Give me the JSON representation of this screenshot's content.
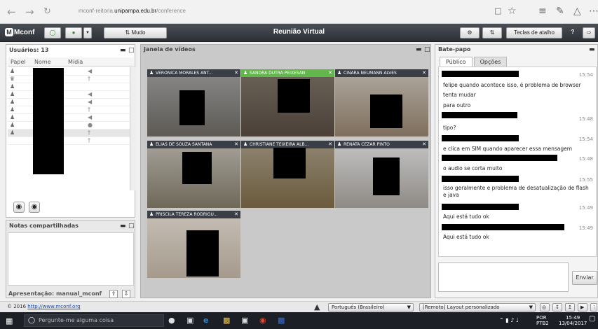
{
  "browser": {
    "url_prefix": "mconf-reitoria.",
    "url_domain": "unipampa.edu.br",
    "url_path": "/conference"
  },
  "toolbar": {
    "logo": "Mconf",
    "mute_label": "Mudo",
    "title": "Reunião Virtual",
    "shortcuts_label": "Teclas de atalho",
    "help_label": "?"
  },
  "users": {
    "title": "Usuários: 13",
    "col_role": "Papel",
    "col_name": "Nome",
    "col_media": "Mídia"
  },
  "notes": {
    "title": "Notas compartilhadas"
  },
  "presentation": {
    "label": "Apresentação: manual_mconf"
  },
  "video": {
    "title": "Janela de vídeos",
    "tiles": [
      {
        "name": "VERONICA MORALES ANT..."
      },
      {
        "name": "SANDRA DUTRA PEIXESAN"
      },
      {
        "name": "CINARA NEUMANN ALVES"
      },
      {
        "name": "ELIAS DE SOUZA SANTANA"
      },
      {
        "name": "CHRISTIANE TEIXEIRA ALB..."
      },
      {
        "name": "RENATA CEZAR PINTO"
      },
      {
        "name": "PRISCILA TEREZA RODRIGU..."
      }
    ]
  },
  "chat": {
    "title": "Bate-papo",
    "tab_public": "Público",
    "tab_options": "Opções",
    "messages": [
      {
        "time": "15:54",
        "text": "felipe quando acontece isso, é problema de browser"
      },
      {
        "time": "",
        "text": "tenta mudar"
      },
      {
        "time": "",
        "text": "para outro"
      },
      {
        "time": "15:48",
        "text": "tipo?"
      },
      {
        "time": "15:54",
        "text": "e clica em SIM quando aparecer essa mensagem"
      },
      {
        "time": "15:48",
        "text": "o audio se corta muito"
      },
      {
        "time": "15:55",
        "text": "isso geralmente e problema de desatualização de flash e java"
      },
      {
        "time": "15:49",
        "text": "Aqui está tudo ok"
      },
      {
        "time": "15:49",
        "text": "Aqui está tudo ok"
      }
    ],
    "send_label": "Enviar"
  },
  "footer": {
    "copyright_prefix": "© 2016 ",
    "copyright_link": "http://www.mconf.org",
    "language": "Português (Brasileiro)",
    "layout": "[Remoto] Layout personalizado"
  },
  "taskbar": {
    "search_placeholder": "Pergunte-me alguma coisa",
    "lang": "POR",
    "lang_sub": "PTB2",
    "time": "15:49",
    "date": "13/04/2017"
  }
}
